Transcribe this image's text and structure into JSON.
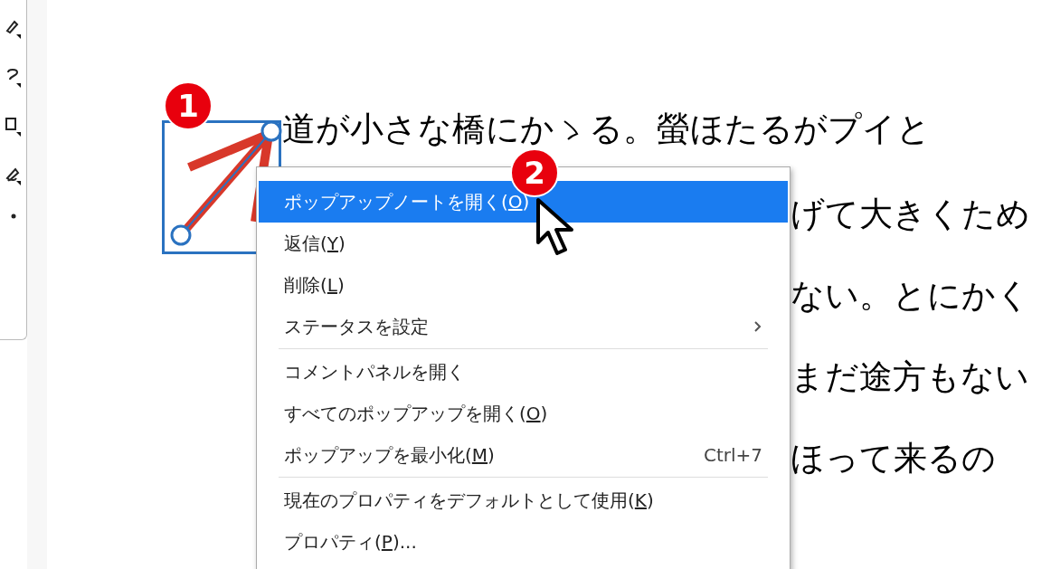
{
  "document": {
    "first_line": {
      "before": "道が小さな橋にか",
      "after": "る。螢ほたるがプイと"
    },
    "fragments": [
      "げて大きくため",
      "ない。とにかく",
      "まだ途方もない",
      "ほって来るの"
    ]
  },
  "badges": [
    "1",
    "2"
  ],
  "context_menu": {
    "groups": [
      [
        {
          "before": "ポップアップノートを開く(",
          "key": "O",
          "after": ")",
          "selected": true,
          "submenu": false
        },
        {
          "before": "返信(",
          "key": "Y",
          "after": ")",
          "selected": false,
          "submenu": false
        },
        {
          "before": "削除(",
          "key": "L",
          "after": ")",
          "selected": false,
          "submenu": false
        },
        {
          "before": "ステータスを設定",
          "selected": false,
          "submenu": true
        }
      ],
      [
        {
          "before": "コメントパネルを開く",
          "selected": false,
          "submenu": false
        },
        {
          "before": "すべてのポップアップを開く(",
          "key": "O",
          "after": ")",
          "selected": false,
          "submenu": false
        },
        {
          "before": "ポップアップを最小化(",
          "key": "M",
          "after": ")",
          "selected": false,
          "submenu": false,
          "shortcut": "Ctrl+7"
        }
      ],
      [
        {
          "before": "現在のプロパティをデフォルトとして使用(",
          "key": "K",
          "after": ")",
          "selected": false,
          "submenu": false
        },
        {
          "before": "プロパティ(",
          "key": "P",
          "after": ")...",
          "selected": false,
          "submenu": false
        }
      ]
    ]
  }
}
